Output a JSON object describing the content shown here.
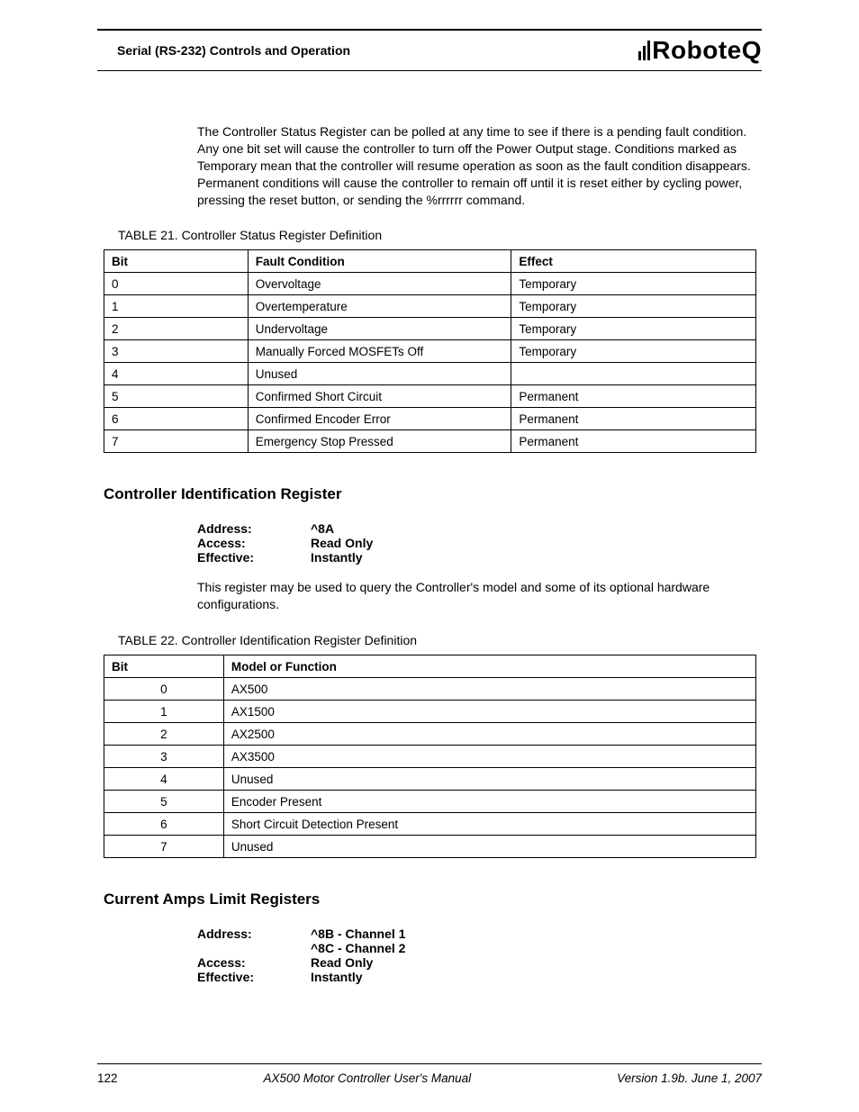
{
  "header": {
    "title": "Serial (RS-232) Controls and Operation",
    "logo_text": "RoboteQ"
  },
  "intro_para": "The Controller Status Register can be polled at any time to see if there is a pending fault condition. Any one bit set will cause the controller to turn off the Power Output stage. Conditions marked as Temporary mean that the controller will resume operation as soon as the fault condition disappears. Permanent conditions will cause the controller to remain off until it is reset either by cycling power, pressing the reset button, or sending the %rrrrrr command.",
  "table1": {
    "caption_label": "TABLE 21. ",
    "caption_text": "Controller Status Register Definition",
    "headers": [
      "Bit",
      "Fault Condition",
      "Effect"
    ],
    "rows": [
      [
        "0",
        "Overvoltage",
        "Temporary"
      ],
      [
        "1",
        "Overtemperature",
        "Temporary"
      ],
      [
        "2",
        "Undervoltage",
        "Temporary"
      ],
      [
        "3",
        "Manually Forced MOSFETs Off",
        "Temporary"
      ],
      [
        "4",
        "Unused",
        ""
      ],
      [
        "5",
        "Confirmed Short Circuit",
        "Permanent"
      ],
      [
        "6",
        "Confirmed Encoder Error",
        "Permanent"
      ],
      [
        "7",
        "Emergency Stop Pressed",
        "Permanent"
      ]
    ]
  },
  "section1": {
    "heading": "Controller Identification Register",
    "kv": [
      {
        "k": "Address:",
        "v": "^8A"
      },
      {
        "k": "Access:",
        "v": "Read Only"
      },
      {
        "k": "Effective:",
        "v": "Instantly"
      }
    ],
    "para": "This register may be used to query the Controller's model and some of its optional hardware configurations."
  },
  "table2": {
    "caption_label": "TABLE 22. ",
    "caption_text": "Controller Identification Register Definition",
    "headers": [
      "Bit",
      "Model or Function"
    ],
    "rows": [
      [
        "0",
        "AX500"
      ],
      [
        "1",
        "AX1500"
      ],
      [
        "2",
        "AX2500"
      ],
      [
        "3",
        "AX3500"
      ],
      [
        "4",
        "Unused"
      ],
      [
        "5",
        "Encoder Present"
      ],
      [
        "6",
        "Short Circuit Detection Present"
      ],
      [
        "7",
        "Unused"
      ]
    ]
  },
  "section2": {
    "heading": "Current Amps Limit Registers",
    "kv": [
      {
        "k": "Address:",
        "v": "^8B - Channel 1"
      },
      {
        "k": "",
        "v": "^8C - Channel 2"
      },
      {
        "k": "Access:",
        "v": "Read Only"
      },
      {
        "k": "Effective:",
        "v": "Instantly"
      }
    ]
  },
  "footer": {
    "page": "122",
    "center": "AX500 Motor Controller User's Manual",
    "right": "Version 1.9b. June 1, 2007"
  }
}
